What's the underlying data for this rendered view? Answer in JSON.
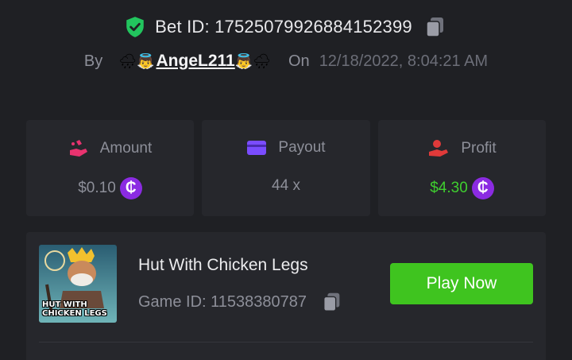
{
  "header": {
    "bet_id_text": "Bet ID: 17525079926884152399",
    "by_label": "By",
    "username": "AngeL211",
    "on_label": "On",
    "date": "12/18/2022, 8:04:21 AM"
  },
  "stats": {
    "amount": {
      "label": "Amount",
      "value": "$0.10",
      "icon": "money-hand-icon"
    },
    "payout": {
      "label": "Payout",
      "value": "44 x",
      "icon": "card-icon"
    },
    "profit": {
      "label": "Profit",
      "value": "$4.30",
      "icon": "profit-hand-icon"
    },
    "coin_symbol": "₵"
  },
  "game": {
    "name": "Hut With Chicken Legs",
    "game_id_text": "Game ID: 11538380787",
    "thumbnail_title": "HUT WITH CHICKEN LEGS",
    "play_label": "Play Now"
  },
  "colors": {
    "background": "#1f2024",
    "card": "#26272c",
    "accent_green": "#3fc41f",
    "profit_green": "#3fcf2f",
    "coin_purple": "#8b2be2",
    "amount_pink": "#e8336f",
    "payout_purple": "#7a4cff",
    "profit_red": "#e03a3a",
    "shield_green": "#22c55e"
  }
}
